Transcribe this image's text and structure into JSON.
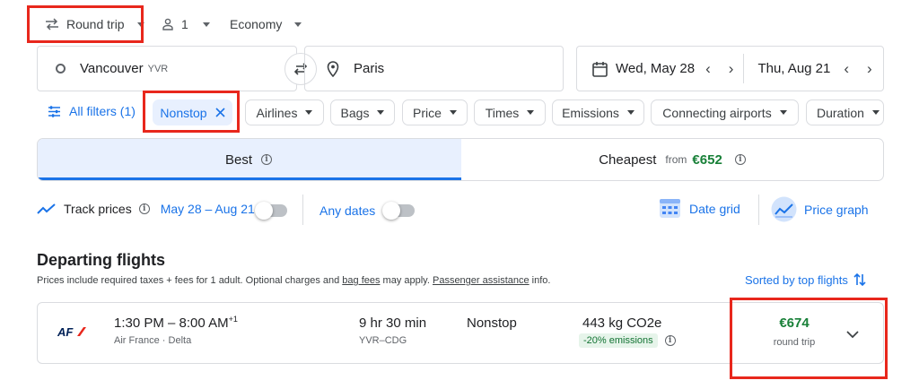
{
  "top_bar": {
    "trip_type": "Round trip",
    "passengers": "1",
    "cabin": "Economy"
  },
  "search": {
    "origin": "Vancouver",
    "origin_code": "YVR",
    "destination": "Paris",
    "depart_date": "Wed, May 28",
    "return_date": "Thu, Aug 21"
  },
  "filters": {
    "all_filters": "All filters (1)",
    "chips": [
      "Nonstop",
      "Airlines",
      "Bags",
      "Price",
      "Times",
      "Emissions",
      "Connecting airports",
      "Duration"
    ]
  },
  "tabs": {
    "best": "Best",
    "cheapest": "Cheapest",
    "cheapest_from": "from",
    "cheapest_price": "€652"
  },
  "track": {
    "label": "Track prices",
    "date_range": "May 28 – Aug 21",
    "any_dates": "Any dates",
    "date_grid": "Date grid",
    "price_graph": "Price graph"
  },
  "results": {
    "heading": "Departing flights",
    "note_prefix": "Prices include required taxes + fees for 1 adult. Optional charges and ",
    "bag_fees": "bag fees",
    "note_middle": " may apply. ",
    "passenger_assistance": "Passenger assistance",
    "note_suffix": " info.",
    "sort_label": "Sorted by top flights"
  },
  "flight": {
    "airline_logo": "AF",
    "times": "1:30 PM – 8:00 AM",
    "day_offset": "+1",
    "airlines": "Air France · Delta",
    "duration": "9 hr 30 min",
    "route": "YVR–CDG",
    "stops": "Nonstop",
    "emissions": "443 kg CO2e",
    "emissions_badge": "-20% emissions",
    "price": "€674",
    "price_type": "round trip"
  },
  "colors": {
    "accent": "#1a73e8",
    "price_green": "#188038",
    "highlight_red": "#e8271c",
    "best_tab_bg": "#e8f0fe"
  }
}
